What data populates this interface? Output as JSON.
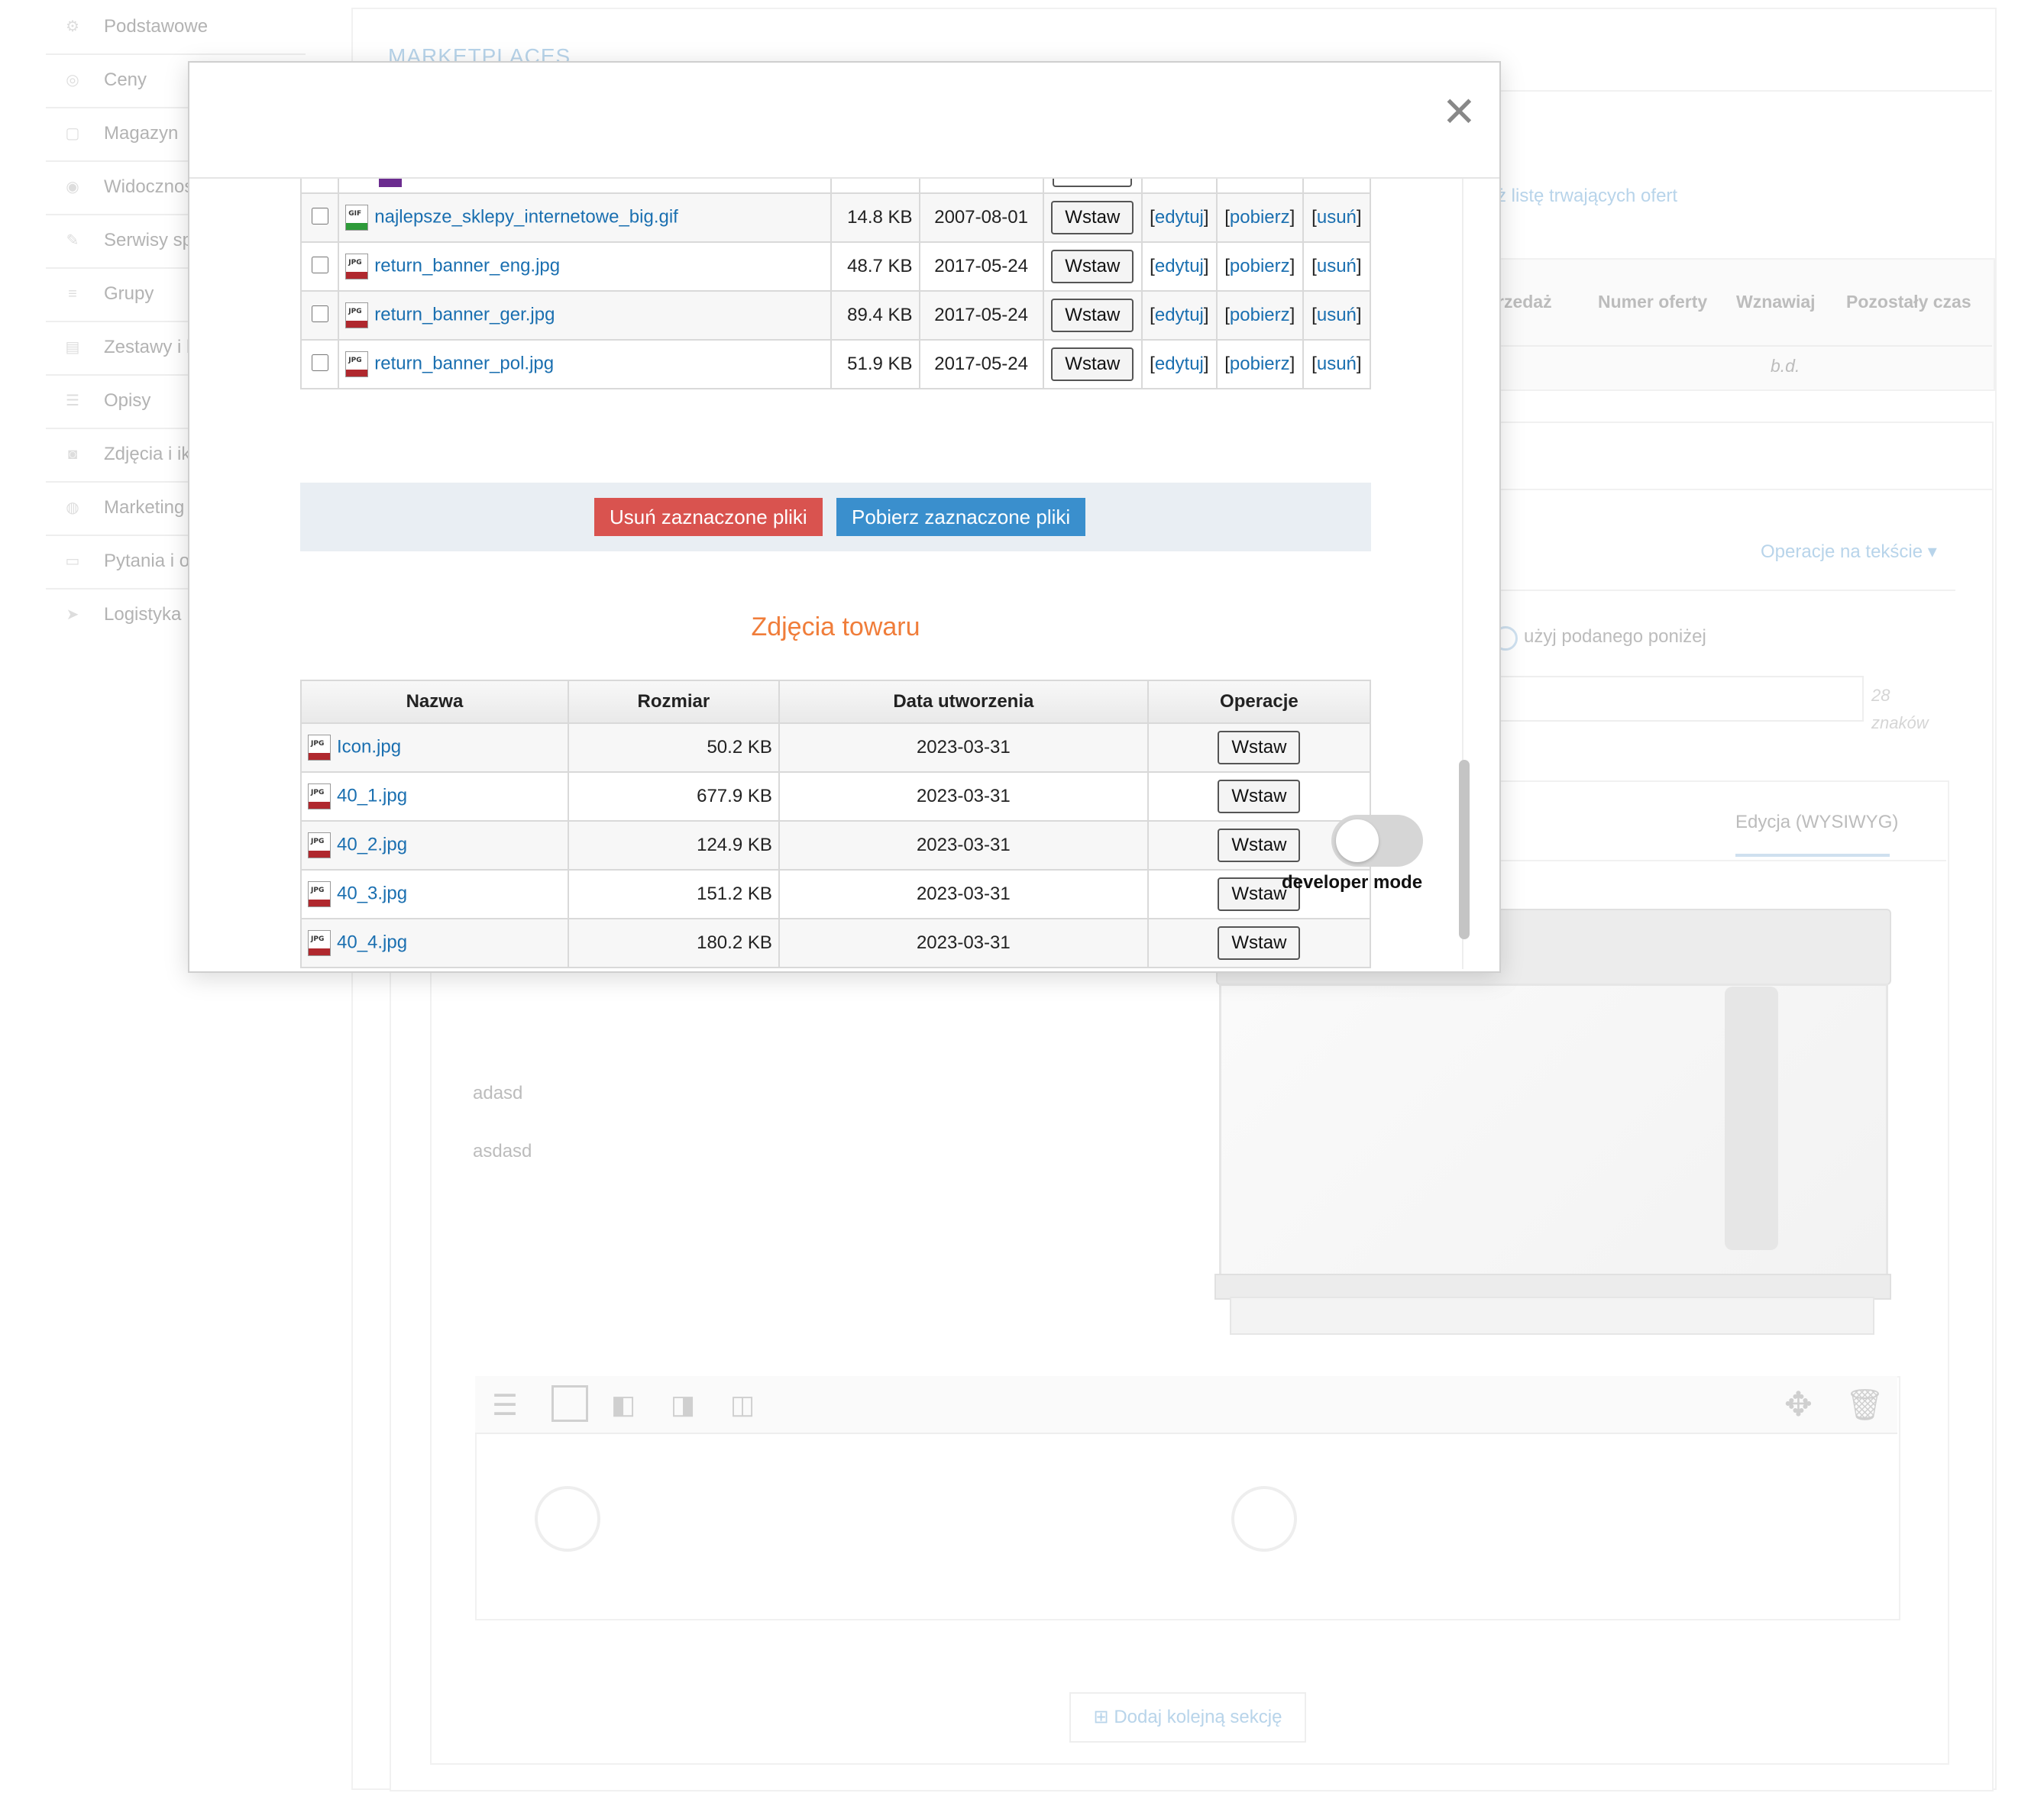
{
  "background": {
    "sidebar": [
      {
        "label": "Podstawowe",
        "icon": "gear-icon"
      },
      {
        "label": "Ceny",
        "icon": "coins-icon"
      },
      {
        "label": "Magazyn",
        "icon": "box-icon"
      },
      {
        "label": "Widocznoś",
        "icon": "eye-icon"
      },
      {
        "label": "Serwisy sp",
        "icon": "wrench-icon"
      },
      {
        "label": "Grupy",
        "icon": "stack-icon"
      },
      {
        "label": "Zestawy i k",
        "icon": "book-icon"
      },
      {
        "label": "Opisy",
        "icon": "lines-icon"
      },
      {
        "label": "Zdjęcia i ik",
        "icon": "camera-icon"
      },
      {
        "label": "Marketing",
        "icon": "globe-icon"
      },
      {
        "label": "Pytania i o",
        "icon": "chat-icon"
      },
      {
        "label": "Logistyka",
        "icon": "plane-icon"
      }
    ],
    "marketplaces_title": "MARKETPLACES",
    "offers_link": "ż listę trwających ofert",
    "offers_headers": [
      "rzedaż",
      "Numer oferty",
      "Wznawiaj",
      "Pozostały czas"
    ],
    "offers_row_value": "b.d.",
    "text_ops": "Operacje na tekście",
    "radio_label": "użyj podanego poniżej",
    "char_count": "28",
    "char_unit": "znaków",
    "wysiwyg_tab": "Edycja (WYSIWYG)",
    "text_line1": "adasd",
    "text_line2": "asdasd",
    "add_section": "Dodaj kolejną sekcję"
  },
  "modal": {
    "files": [
      {
        "name": "najlepsze_sklepy_internetowe_big.gif",
        "type": "GIF",
        "size": "14.8 KB",
        "date": "2007-08-01"
      },
      {
        "name": "return_banner_eng.jpg",
        "type": "JPG",
        "size": "48.7 KB",
        "date": "2017-05-24"
      },
      {
        "name": "return_banner_ger.jpg",
        "type": "JPG",
        "size": "89.4 KB",
        "date": "2017-05-24"
      },
      {
        "name": "return_banner_pol.jpg",
        "type": "JPG",
        "size": "51.9 KB",
        "date": "2017-05-24"
      }
    ],
    "insert_label": "Wstaw",
    "edit_label": "edytuj",
    "download_label": "pobierz",
    "delete_label": "usuń",
    "delete_selected": "Usuń zaznaczone pliki",
    "download_selected": "Pobierz zaznaczone pliki",
    "photos_title": "Zdjęcia towaru",
    "photos_headers": {
      "name": "Nazwa",
      "size": "Rozmiar",
      "date": "Data utworzenia",
      "ops": "Operacje"
    },
    "photos": [
      {
        "name": "Icon.jpg",
        "size": "50.2 KB",
        "date": "2023-03-31"
      },
      {
        "name": "40_1.jpg",
        "size": "677.9 KB",
        "date": "2023-03-31"
      },
      {
        "name": "40_2.jpg",
        "size": "124.9 KB",
        "date": "2023-03-31"
      },
      {
        "name": "40_3.jpg",
        "size": "151.2 KB",
        "date": "2023-03-31"
      },
      {
        "name": "40_4.jpg",
        "size": "180.2 KB",
        "date": "2023-03-31"
      }
    ],
    "developer_mode": "developer mode",
    "colors": {
      "danger": "#d9534f",
      "primary": "#3a8fcd",
      "title": "#f07d3a",
      "link": "#1a6fb0"
    }
  }
}
